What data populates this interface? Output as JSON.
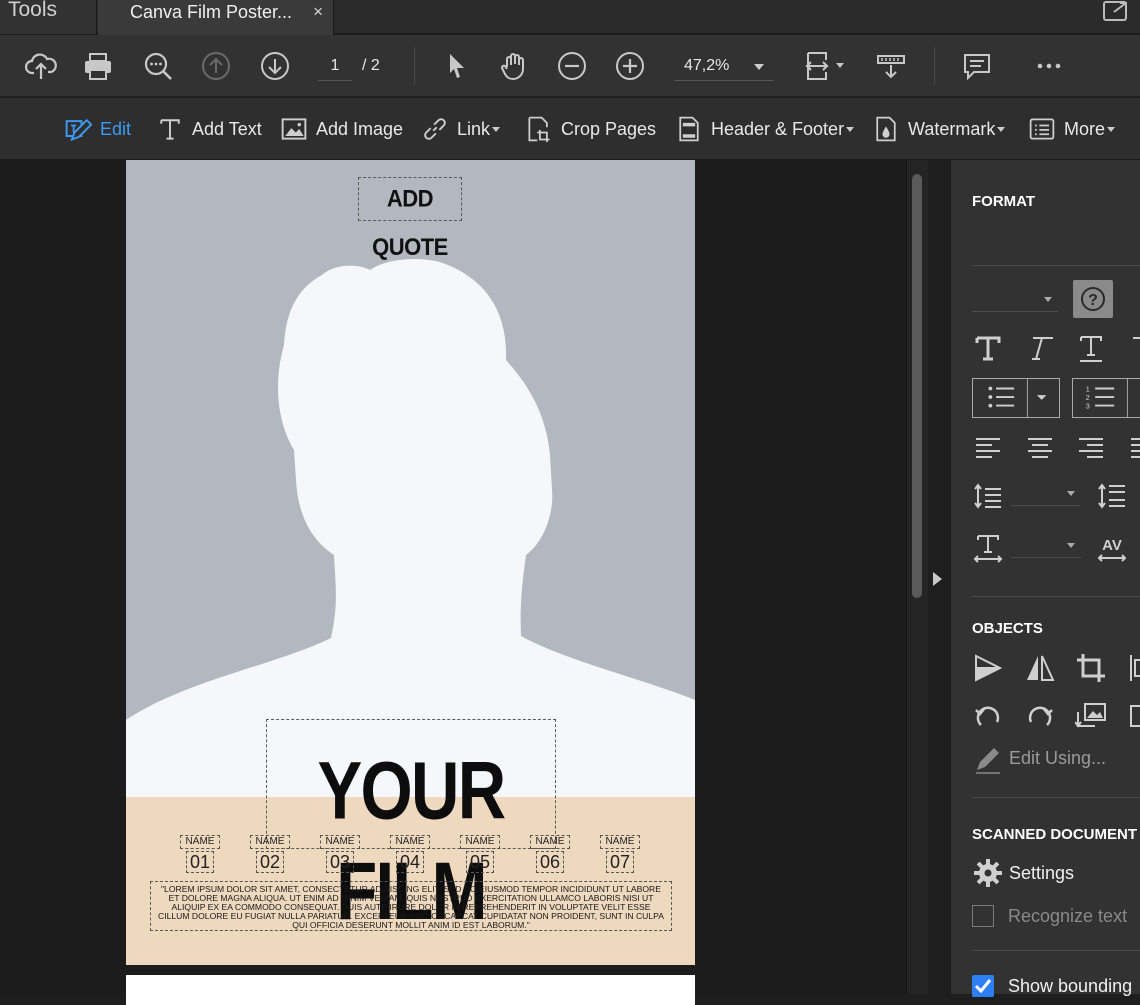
{
  "tabs": {
    "tools_label": "Tools",
    "document_title": "Canva Film Poster...",
    "close_glyph": "×"
  },
  "toolbar": {
    "page_current": "1",
    "page_total": "/ 2",
    "zoom": "47,2%",
    "icons": [
      "upload-cloud-icon",
      "print-icon",
      "zoom-search-icon",
      "prev-page-icon",
      "next-page-icon",
      "select-pointer-icon",
      "hand-tool-icon",
      "zoom-out-icon",
      "zoom-in-icon",
      "page-fit-icon",
      "scroll-mode-icon",
      "comment-icon",
      "more-icon"
    ]
  },
  "edit_toolbar": {
    "edit": "Edit",
    "add_text": "Add Text",
    "add_image": "Add Image",
    "link": "Link",
    "crop_pages": "Crop Pages",
    "header_footer": "Header & Footer",
    "watermark": "Watermark",
    "more": "More",
    "accent": "#3d9bf5"
  },
  "poster": {
    "quote": "ADD QUOTE",
    "title": "YOUR FILM",
    "credits": [
      {
        "name": "NAME",
        "number": "01"
      },
      {
        "name": "NAME",
        "number": "02"
      },
      {
        "name": "NAME",
        "number": "03"
      },
      {
        "name": "NAME",
        "number": "04"
      },
      {
        "name": "NAME",
        "number": "05"
      },
      {
        "name": "NAME",
        "number": "06"
      },
      {
        "name": "NAME",
        "number": "07"
      }
    ],
    "body": "\"Lorem ipsum dolor sit amet, consectetur adipiscing elit, sed do eiusmod tempor incididunt ut labore et dolore magna aliqua. Ut enim ad minim veniam, quis nostrud exercitation ullamco laboris nisi ut aliquip ex ea commodo consequat. Duis aute irure dolor in reprehenderit in voluptate velit esse cillum dolore eu fugiat nulla pariatur. Excepteur sint occaecat cupidatat non proident, sunt in culpa qui officia deserunt mollit anim id est laborum.\"",
    "colors": {
      "background": "#b2b8bf",
      "silhouette": "#f5f7fa",
      "band": "#eed8be"
    }
  },
  "panel": {
    "format_heading": "FORMAT",
    "objects_heading": "OBJECTS",
    "edit_using": "Edit Using...",
    "scanned_heading": "SCANNED DOCUMENT",
    "settings": "Settings",
    "recognize_text": "Recognize text",
    "recognize_checked": false,
    "show_bounding": "Show bounding",
    "show_bounding_checked": true
  }
}
